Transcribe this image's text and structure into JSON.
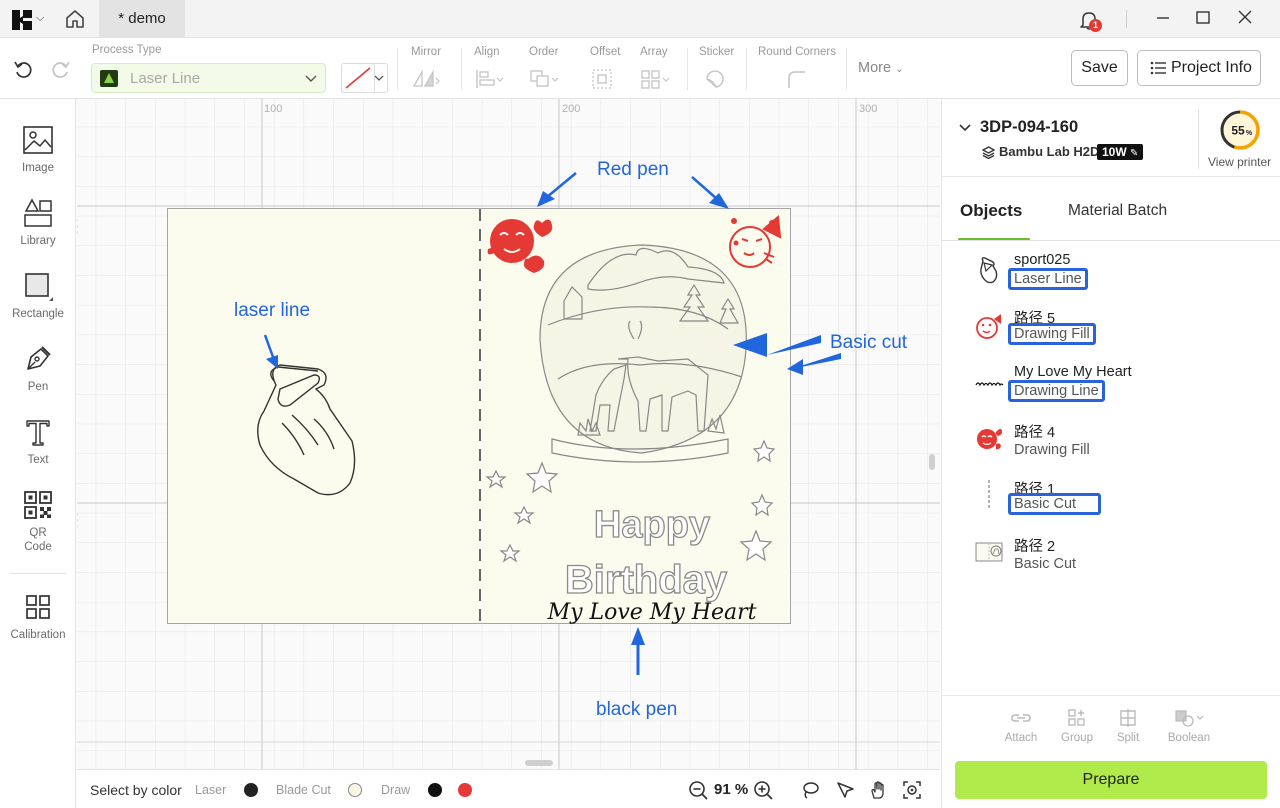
{
  "titlebar": {
    "document_tab": "* demo",
    "notification_count": "1"
  },
  "toolbar": {
    "process_type_label": "Process Type",
    "process_type_value": "Laser Line",
    "mirror_label": "Mirror",
    "align_label": "Align",
    "order_label": "Order",
    "offset_label": "Offset",
    "array_label": "Array",
    "sticker_label": "Sticker",
    "round_corners_label": "Round Corners",
    "more_label": "More",
    "save_label": "Save",
    "project_info_label": "Project Info"
  },
  "sidebar": {
    "items": [
      {
        "label": "Image",
        "icon": "image-icon"
      },
      {
        "label": "Library",
        "icon": "library-icon"
      },
      {
        "label": "Rectangle",
        "icon": "rectangle-icon"
      },
      {
        "label": "Pen",
        "icon": "pen-icon"
      },
      {
        "label": "Text",
        "icon": "text-icon"
      },
      {
        "label": "QR\nCode",
        "icon": "qr-code-icon"
      },
      {
        "label": "Calibration",
        "icon": "calibration-icon"
      }
    ]
  },
  "canvas": {
    "ruler_labels": [
      "100",
      "200",
      "300",
      "100",
      "200"
    ],
    "card": {
      "happy_text": "Happy",
      "birthday_text": "Birthday",
      "script_text": "My Love My Heart"
    },
    "annotations": {
      "red_pen": "Red pen",
      "laser_line": "laser line",
      "basic_cut": "Basic cut",
      "black_pen": "black pen"
    }
  },
  "statusbar": {
    "select_by_color": "Select by color",
    "laser": "Laser",
    "blade_cut": "Blade Cut",
    "draw": "Draw",
    "zoom": "91 %",
    "colors": {
      "laser": "#222222",
      "blade": "#f3f3dc",
      "draw_black": "#111111",
      "draw_red": "#e53935"
    }
  },
  "device": {
    "name": "3DP-094-160",
    "printer": "Bambu Lab H2D",
    "power": "10W",
    "progress_value": 55,
    "progress_text": "55",
    "progress_unit": "%",
    "view_printer": "View printer"
  },
  "panel": {
    "tab_objects": "Objects",
    "tab_material_batch": "Material Batch",
    "objects": [
      {
        "name": "sport025",
        "type": "Laser Line",
        "boxed": true
      },
      {
        "name": "路径 5",
        "type": "Drawing Fill",
        "boxed": true
      },
      {
        "name": "My Love My Heart",
        "type": "Drawing Line",
        "boxed": true
      },
      {
        "name": "路径 4",
        "type": "Drawing Fill",
        "boxed": false
      },
      {
        "name": "路径 1",
        "type": "Basic Cut",
        "boxed": true
      },
      {
        "name": "路径 2",
        "type": "Basic Cut",
        "boxed": false
      }
    ],
    "actions": {
      "attach": "Attach",
      "group": "Group",
      "split": "Split",
      "boolean": "Boolean"
    },
    "prepare_label": "Prepare"
  },
  "colors": {
    "accent_green": "#b1eb4b",
    "annotation_blue": "#2266dd",
    "red_pen": "#e53935"
  }
}
